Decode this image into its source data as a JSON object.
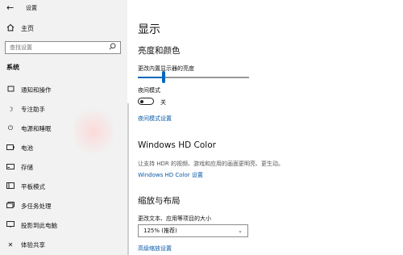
{
  "window": {
    "title": "设置"
  },
  "sidebar": {
    "home_label": "主页",
    "search_placeholder": "查找设置",
    "section_label": "系统",
    "items": [
      {
        "label": "通知和操作",
        "icon": "notification-icon"
      },
      {
        "label": "专注助手",
        "icon": "moon-icon"
      },
      {
        "label": "电源和睡眠",
        "icon": "power-icon"
      },
      {
        "label": "电池",
        "icon": "battery-icon"
      },
      {
        "label": "存储",
        "icon": "storage-icon"
      },
      {
        "label": "平板模式",
        "icon": "tablet-icon"
      },
      {
        "label": "多任务处理",
        "icon": "multitask-icon"
      },
      {
        "label": "投影到此电脑",
        "icon": "project-icon"
      },
      {
        "label": "体验共享",
        "icon": "share-icon"
      }
    ]
  },
  "main": {
    "page_title": "显示",
    "brightness": {
      "heading": "亮度和颜色",
      "slider_label": "更改内置显示器的亮度",
      "value_percent": 23
    },
    "night_light": {
      "label": "夜间模式",
      "state": "关",
      "settings_link": "夜间模式设置"
    },
    "hdr": {
      "heading": "Windows HD Color",
      "description": "让支持 HDR 的视频、游戏和应用的画面更明亮、更生动。",
      "settings_link": "Windows HD Color 设置"
    },
    "scale": {
      "heading": "缩放与布局",
      "label": "更改文本、应用等项目的大小",
      "selected": "125% (推荐)",
      "advanced_link": "高级缩放设置"
    }
  },
  "colors": {
    "accent": "#0068c0",
    "link": "#0a5aa8",
    "sidebar_bg": "#f2f2f2"
  }
}
